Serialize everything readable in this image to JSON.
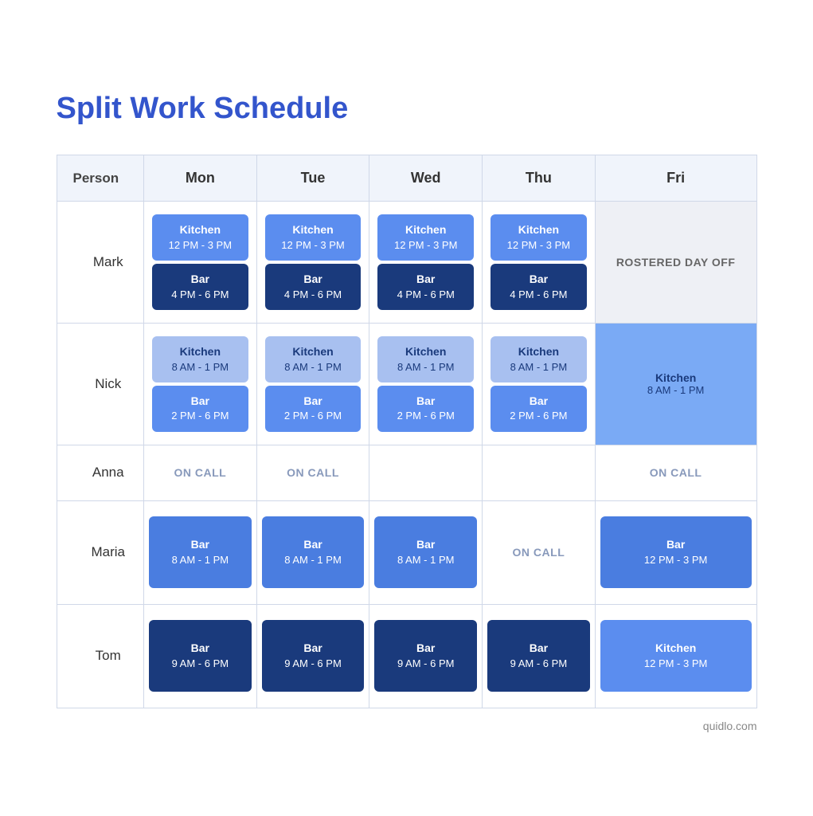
{
  "title": "Split Work Schedule",
  "header": {
    "person": "Person",
    "days": [
      "Mon",
      "Tue",
      "Wed",
      "Thu",
      "Fri"
    ]
  },
  "rows": [
    {
      "name": "Mark",
      "shifts": [
        {
          "type": "stacked",
          "top": {
            "name": "Kitchen",
            "time": "12 PM - 3 PM",
            "color": "kitchen"
          },
          "bottom": {
            "name": "Bar",
            "time": "4 PM  - 6 PM",
            "color": "bar-dark"
          }
        },
        {
          "type": "stacked",
          "top": {
            "name": "Kitchen",
            "time": "12 PM - 3 PM",
            "color": "kitchen"
          },
          "bottom": {
            "name": "Bar",
            "time": "4 PM  - 6 PM",
            "color": "bar-dark"
          }
        },
        {
          "type": "stacked",
          "top": {
            "name": "Kitchen",
            "time": "12 PM - 3 PM",
            "color": "kitchen"
          },
          "bottom": {
            "name": "Bar",
            "time": "4 PM  - 6 PM",
            "color": "bar-dark"
          }
        },
        {
          "type": "stacked",
          "top": {
            "name": "Kitchen",
            "time": "12 PM - 3 PM",
            "color": "kitchen"
          },
          "bottom": {
            "name": "Bar",
            "time": "4 PM  - 6 PM",
            "color": "bar-dark"
          }
        },
        {
          "type": "rostered",
          "text": "ROSTERED DAY OFF"
        }
      ]
    },
    {
      "name": "Nick",
      "shifts": [
        {
          "type": "stacked",
          "top": {
            "name": "Kitchen",
            "time": "8 AM - 1 PM",
            "color": "kitchen-light"
          },
          "bottom": {
            "name": "Bar",
            "time": "2 PM  - 6 PM",
            "color": "bar-medium"
          }
        },
        {
          "type": "stacked",
          "top": {
            "name": "Kitchen",
            "time": "8 AM - 1 PM",
            "color": "kitchen-light"
          },
          "bottom": {
            "name": "Bar",
            "time": "2 PM  - 6 PM",
            "color": "bar-medium"
          }
        },
        {
          "type": "stacked",
          "top": {
            "name": "Kitchen",
            "time": "8 AM - 1 PM",
            "color": "kitchen-light"
          },
          "bottom": {
            "name": "Bar",
            "time": "2 PM  - 6 PM",
            "color": "bar-medium"
          }
        },
        {
          "type": "stacked",
          "top": {
            "name": "Kitchen",
            "time": "8 AM - 1 PM",
            "color": "kitchen-light"
          },
          "bottom": {
            "name": "Bar",
            "time": "2 PM  - 6 PM",
            "color": "bar-medium"
          }
        },
        {
          "type": "single-light",
          "name": "Kitchen",
          "time": "8 AM - 1 PM"
        }
      ]
    },
    {
      "name": "Anna",
      "shifts": [
        {
          "type": "oncall"
        },
        {
          "type": "oncall"
        },
        {
          "type": "empty"
        },
        {
          "type": "empty"
        },
        {
          "type": "oncall"
        }
      ]
    },
    {
      "name": "Maria",
      "shifts": [
        {
          "type": "single",
          "name": "Bar",
          "time": "8 AM  - 1 PM",
          "color": "bar-blue"
        },
        {
          "type": "single",
          "name": "Bar",
          "time": "8 AM  - 1 PM",
          "color": "bar-blue"
        },
        {
          "type": "single",
          "name": "Bar",
          "time": "8 AM  - 1 PM",
          "color": "bar-blue"
        },
        {
          "type": "oncall"
        },
        {
          "type": "single",
          "name": "Bar",
          "time": "12 PM - 3 PM",
          "color": "bar-blue"
        }
      ]
    },
    {
      "name": "Tom",
      "shifts": [
        {
          "type": "single",
          "name": "Bar",
          "time": "9 AM  - 6 PM",
          "color": "bar-tom"
        },
        {
          "type": "single",
          "name": "Bar",
          "time": "9 AM  - 6 PM",
          "color": "bar-tom"
        },
        {
          "type": "single",
          "name": "Bar",
          "time": "9 AM  - 6 PM",
          "color": "bar-tom"
        },
        {
          "type": "single",
          "name": "Bar",
          "time": "9 AM  - 6 PM",
          "color": "bar-tom"
        },
        {
          "type": "single",
          "name": "Kitchen",
          "time": "12 PM  - 3 PM",
          "color": "kitchen-tom"
        }
      ]
    }
  ],
  "footer": "quidlo.com"
}
